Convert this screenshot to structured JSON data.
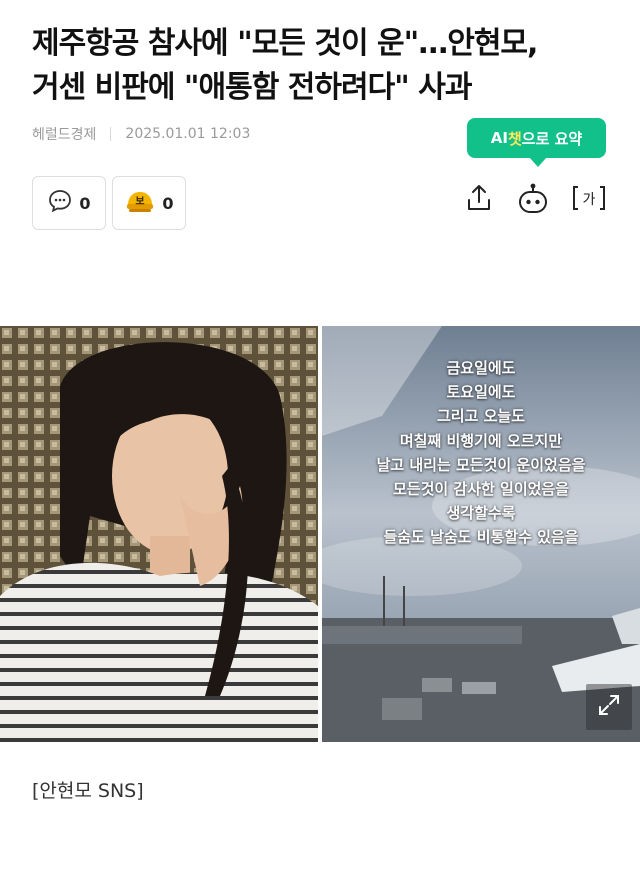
{
  "article": {
    "headline_line1": "제주항공 참사에 \"모든 것이 운\"…안현모,",
    "headline_line2": "거센 비판에 \"애통함 전하려다\" 사과",
    "source": "헤럴드경제",
    "datetime": "2025.01.01 12:03",
    "caption": "[안현모 SNS]"
  },
  "ai_summary": {
    "prefix": "AI",
    "highlight": "챗",
    "suffix": "으로 요약"
  },
  "reactions": {
    "comment_count": "0",
    "reaction_count": "0",
    "reaction_icon_text": "보"
  },
  "toolbar": {
    "font_icon_text": "가"
  },
  "sns_post_lines": [
    "금요일에도",
    "토요일에도",
    "그리고 오늘도",
    "며칠째 비행기에 오르지만",
    "날고 내리는 모든것이 운이었음을",
    "모든것이 감사한 일이었음을",
    "생각할수록",
    "들숨도 날숨도 비통할수 있음을"
  ],
  "colors": {
    "accent": "#12c08a",
    "accent_highlight": "#ffe95c",
    "meta_text": "#9a9a9a"
  },
  "icons": [
    "comment-icon",
    "reaction-icon",
    "share-icon",
    "ai-bot-icon",
    "font-size-icon",
    "expand-icon"
  ]
}
